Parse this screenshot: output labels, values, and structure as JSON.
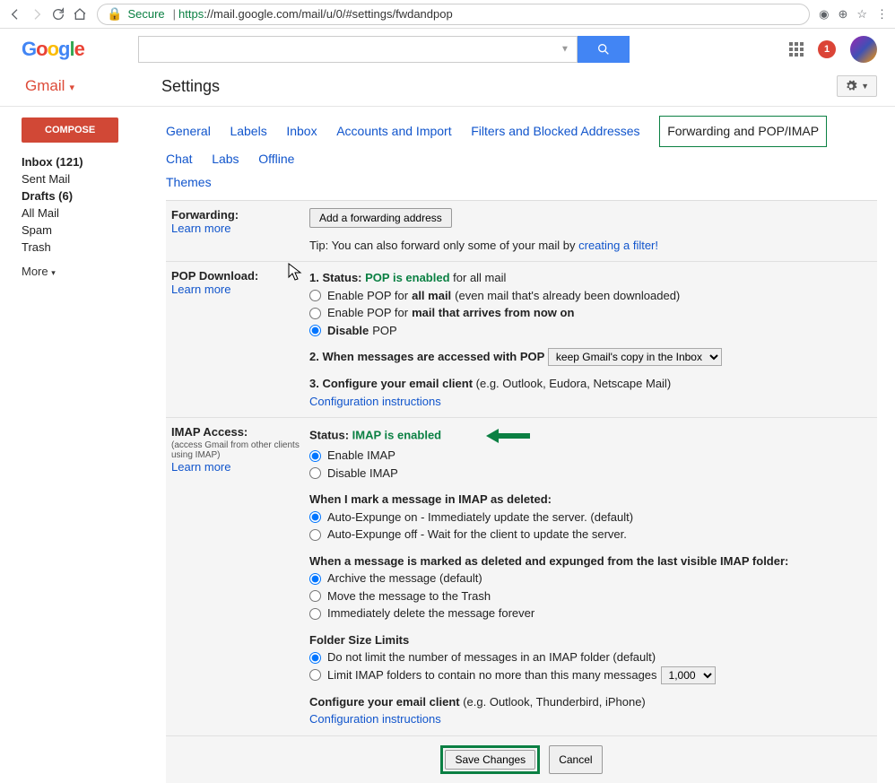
{
  "browser": {
    "secure_label": "Secure",
    "url_prefix": "https",
    "url_rest": "://mail.google.com/mail/u/0/#settings/fwdandpop"
  },
  "logo": {
    "g1": "G",
    "g2": "o",
    "g3": "o",
    "g4": "g",
    "g5": "l",
    "g6": "e"
  },
  "header": {
    "notifications": "1"
  },
  "subheader": {
    "gmail": "Gmail",
    "title": "Settings"
  },
  "sidebar": {
    "compose": "COMPOSE",
    "items": [
      {
        "label": "Inbox (121)",
        "bold": true
      },
      {
        "label": "Sent Mail",
        "bold": false
      },
      {
        "label": "Drafts (6)",
        "bold": true
      },
      {
        "label": "All Mail",
        "bold": false
      },
      {
        "label": "Spam",
        "bold": false
      },
      {
        "label": "Trash",
        "bold": false
      }
    ],
    "more": "More"
  },
  "tabs": [
    "General",
    "Labels",
    "Inbox",
    "Accounts and Import",
    "Filters and Blocked Addresses",
    "Forwarding and POP/IMAP",
    "Chat",
    "Labs",
    "Offline",
    "Themes"
  ],
  "active_tab": "Forwarding and POP/IMAP",
  "forwarding": {
    "label": "Forwarding:",
    "learn": "Learn more",
    "add_btn": "Add a forwarding address",
    "tip_prefix": "Tip: You can also forward only some of your mail by ",
    "tip_link": "creating a filter!"
  },
  "pop": {
    "label": "POP Download:",
    "learn": "Learn more",
    "status_prefix": "1. Status: ",
    "status_value": "POP is enabled",
    "status_suffix": " for all mail",
    "opt1_prefix": "Enable POP for ",
    "opt1_bold": "all mail",
    "opt1_suffix": " (even mail that's already been downloaded)",
    "opt2_prefix": "Enable POP for ",
    "opt2_bold": "mail that arrives from now on",
    "opt3_bold": "Disable",
    "opt3_suffix": " POP",
    "access_label": "2. When messages are accessed with POP",
    "access_select": "keep Gmail's copy in the Inbox",
    "configure_prefix": "3. Configure your email client",
    "configure_suffix": " (e.g. Outlook, Eudora, Netscape Mail)",
    "configure_link": "Configuration instructions"
  },
  "imap": {
    "label": "IMAP Access:",
    "sub": "(access Gmail from other clients using IMAP)",
    "learn": "Learn more",
    "status_prefix": "Status: ",
    "status_value": "IMAP is enabled",
    "enable": "Enable IMAP",
    "disable": "Disable IMAP",
    "deleted_heading": "When I mark a message in IMAP as deleted:",
    "expunge_on": "Auto-Expunge on - Immediately update the server. (default)",
    "expunge_off": "Auto-Expunge off - Wait for the client to update the server.",
    "expunged_heading": "When a message is marked as deleted and expunged from the last visible IMAP folder:",
    "archive": "Archive the message (default)",
    "trash": "Move the message to the Trash",
    "delete_forever": "Immediately delete the message forever",
    "folder_heading": "Folder Size Limits",
    "folder_nolimit": "Do not limit the number of messages in an IMAP folder (default)",
    "folder_limit_prefix": "Limit IMAP folders to contain no more than this many messages",
    "folder_limit_value": "1,000",
    "configure_prefix": "Configure your email client",
    "configure_suffix": " (e.g. Outlook, Thunderbird, iPhone)",
    "configure_link": "Configuration instructions"
  },
  "buttons": {
    "save": "Save Changes",
    "cancel": "Cancel"
  }
}
